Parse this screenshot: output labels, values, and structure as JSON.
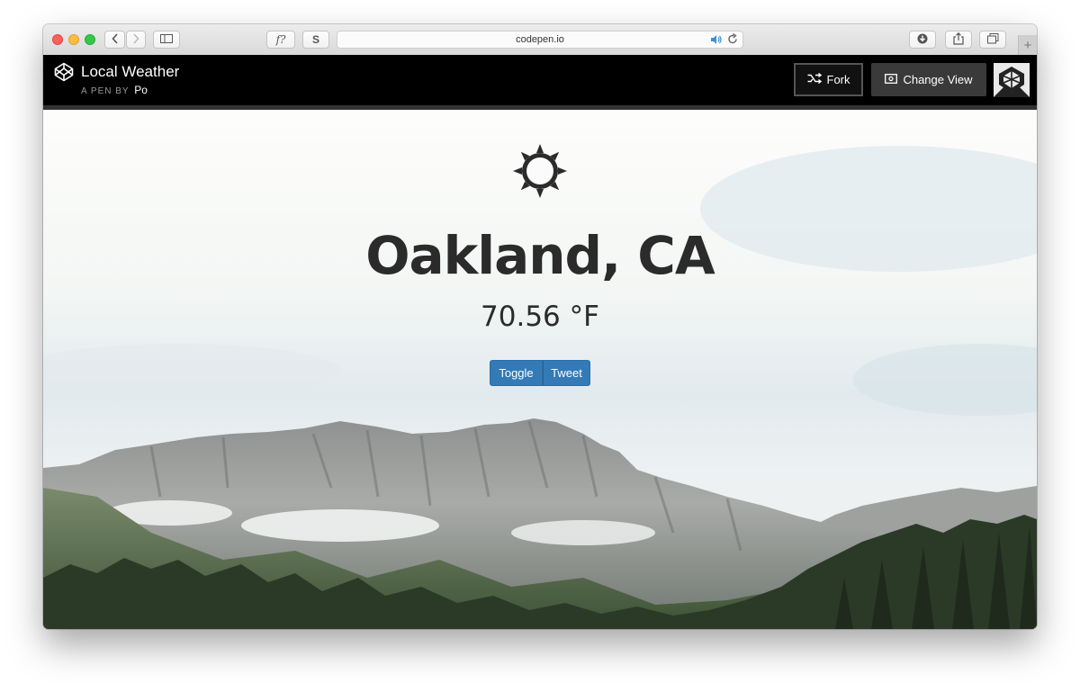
{
  "browser": {
    "address": "codepen.io",
    "font_button_label": "f?",
    "s_button_label": "S",
    "new_tab_label": "+"
  },
  "header": {
    "title": "Local Weather",
    "by_label": "A PEN BY",
    "author": "Po",
    "fork_label": "Fork",
    "change_view_label": "Change View"
  },
  "weather": {
    "icon": "sun-icon",
    "city": "Oakland, CA",
    "temperature": "70.56 °F",
    "toggle_label": "Toggle",
    "tweet_label": "Tweet"
  },
  "colors": {
    "button_blue": "#337ab7",
    "header_black": "#000000",
    "text_dark": "#2b2b2b"
  }
}
